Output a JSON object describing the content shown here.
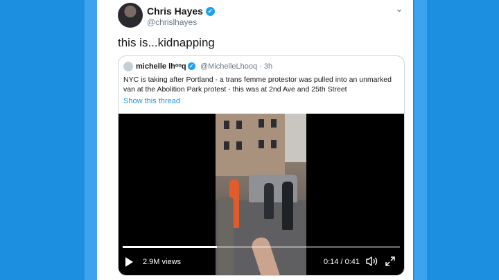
{
  "tweet": {
    "author_name": "Chris Hayes",
    "handle": "@chrislhayes",
    "text": "this is...kidnapping",
    "caret": "⌄"
  },
  "quoted": {
    "author_name": "michelle lhᵒᵒq",
    "handle_time": "@MichelleLhooq · 3h",
    "text": "NYC is taking after Portland - a trans femme protestor was pulled into an unmarked van at the Abolition Park protest - this was at 2nd Ave and 25th Street",
    "show_thread": "Show this thread"
  },
  "video": {
    "views": "2.9M views",
    "time": "0:14 / 0:41",
    "progress": 0.34
  },
  "colors": {
    "background": "#1d8fe0",
    "link": "#1b95e0",
    "verified": "#1da1f2"
  }
}
